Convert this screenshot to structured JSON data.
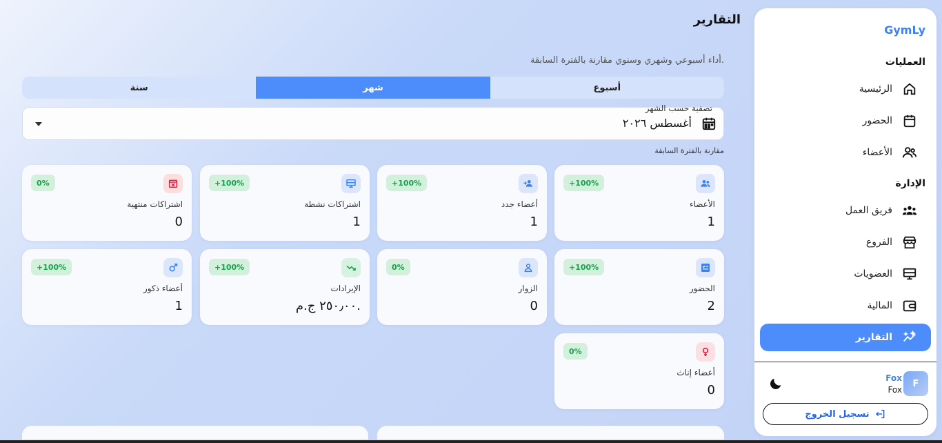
{
  "sidebar": {
    "brand": "GymLy",
    "section_operations": "العمليات",
    "section_admin": "الإدارة",
    "items": [
      {
        "label": "الرئيسية"
      },
      {
        "label": "الحضور"
      },
      {
        "label": "الأعضاء"
      },
      {
        "label": "فريق العمل"
      },
      {
        "label": "الفروع"
      },
      {
        "label": "العضويات"
      },
      {
        "label": "المالية"
      },
      {
        "label": "التقارير"
      }
    ],
    "user": {
      "initial": "F",
      "name": "Fox",
      "sub": "Fox"
    },
    "logout_label": "تسجيل الخروج"
  },
  "page": {
    "title": "التقارير",
    "subtitle": "أداء أسبوعي وشهري وسنوي مقارنة بالفترة السابقة.",
    "tabs": [
      "أسبوع",
      "شهر",
      "سنة"
    ],
    "active_tab": "شهر",
    "filter_label": "تصفية حسب الشهر",
    "filter_value": "أغسطس ٢٠٢٦",
    "compare_note": "مقارنة بالفترة السابقة"
  },
  "cards": [
    {
      "label": "الأعضاء",
      "value": "1",
      "badge": "+100%",
      "icon": "users-icon"
    },
    {
      "label": "أعضاء جدد",
      "value": "1",
      "badge": "+100%",
      "icon": "user-plus-icon"
    },
    {
      "label": "اشتراكات نشطة",
      "value": "1",
      "badge": "+100%",
      "icon": "card-icon"
    },
    {
      "label": "اشتراكات منتهية",
      "value": "0",
      "badge": "0%",
      "icon": "calendar-x-icon"
    },
    {
      "label": "الحضور",
      "value": "2",
      "badge": "+100%",
      "icon": "checklist-icon"
    },
    {
      "label": "الزوار",
      "value": "0",
      "badge": "0%",
      "icon": "user-icon"
    },
    {
      "label": "الإيرادات",
      "value": "٢٥٠٫٠٠ ج.م.",
      "badge": "+100%",
      "icon": "trend-icon"
    },
    {
      "label": "أعضاء ذكور",
      "value": "1",
      "badge": "+100%",
      "icon": "male-icon"
    },
    {
      "label": "أعضاء إناث",
      "value": "0",
      "badge": "0%",
      "icon": "female-icon"
    }
  ],
  "colors": {
    "accent": "#4d8dfb",
    "brand": "#3b82f6",
    "positive": "#16a34a"
  }
}
